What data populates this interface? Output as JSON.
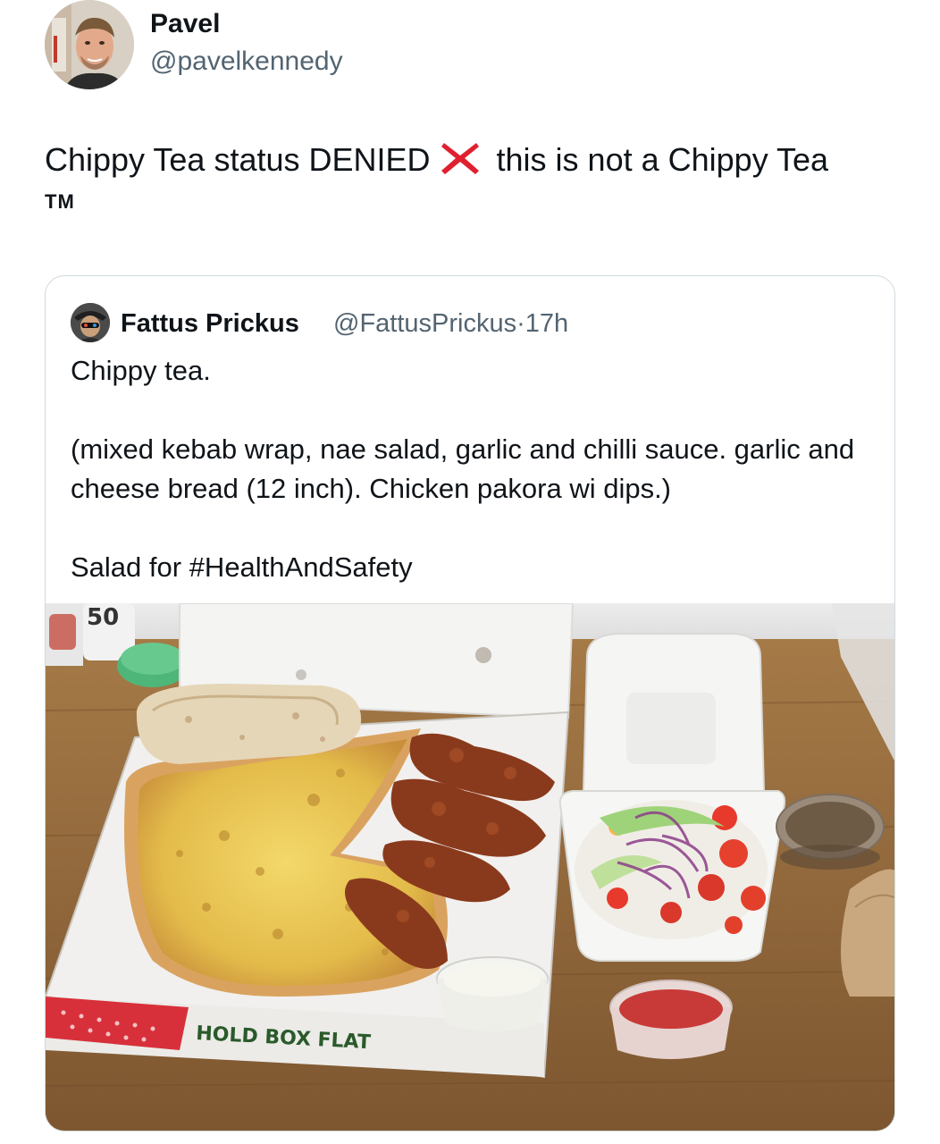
{
  "tweet": {
    "author": {
      "name": "Pavel",
      "handle": "@pavelkennedy",
      "avatar_icon": "profile-photo"
    },
    "text_before_icon": "Chippy Tea status DENIED",
    "inline_icon": "red-cross-mark",
    "text_after_icon": " this is not a Chippy Tea",
    "trademark": "TM"
  },
  "quoted_tweet": {
    "author": {
      "name": "Fattus Prickus",
      "handle": "@FattusPrickus",
      "separator": "·",
      "time": "17h",
      "avatar_icon": "profile-photo"
    },
    "line1": "Chippy tea.",
    "line2": "(mixed kebab wrap, nae salad, garlic and chilli sauce. garlic and cheese bread (12 inch). Chicken pakora wi dips.)",
    "line3": "Salad for #HealthAndSafety",
    "photo": {
      "box_print": "HOLD BOX FLAT",
      "bottle_label": "50"
    }
  },
  "colors": {
    "text_primary": "#0f1419",
    "text_secondary": "#536471",
    "card_border": "#cfd9de",
    "cross_red": "#e0202e"
  }
}
